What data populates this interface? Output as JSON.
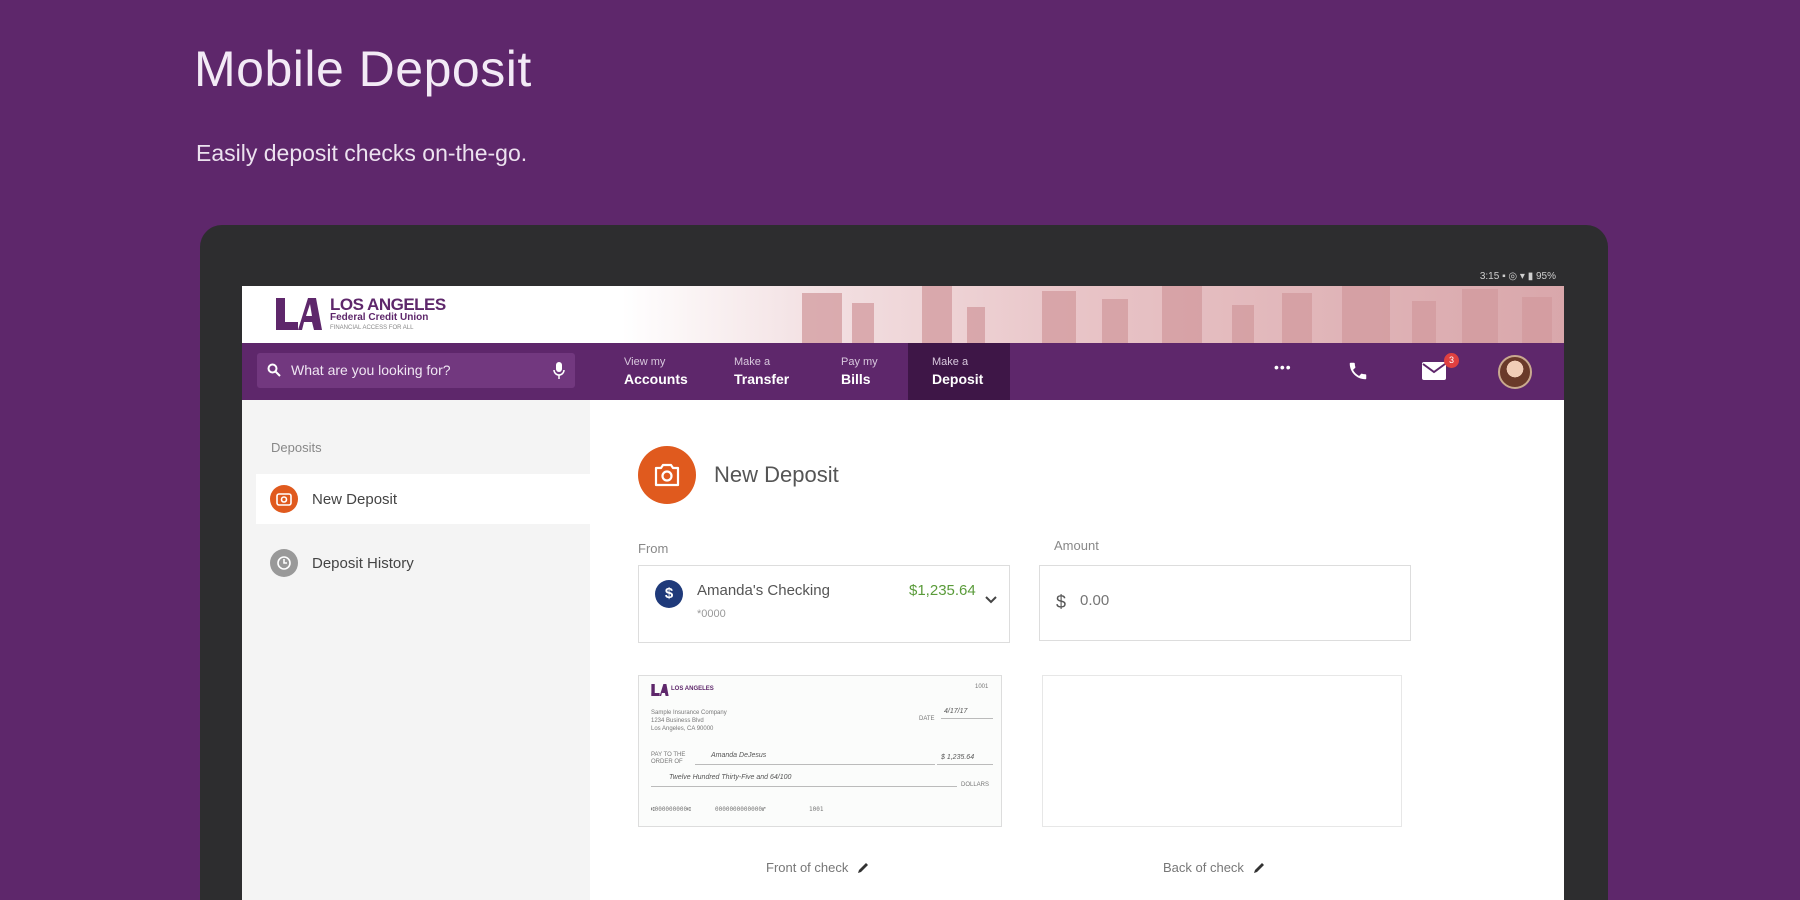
{
  "hero": {
    "title": "Mobile Deposit",
    "subtitle": "Easily deposit checks on-the-go."
  },
  "statusbar": {
    "text": "3:15 ▪ ◎ ▾ ▮ 95%"
  },
  "logo": {
    "line1": "LOS ANGELES",
    "line2": "Federal Credit Union",
    "line3": "FINANCIAL ACCESS FOR ALL",
    "mark": "LA"
  },
  "search": {
    "placeholder": "What are you looking for?"
  },
  "nav": {
    "tabs": [
      {
        "small": "View my",
        "big": "Accounts"
      },
      {
        "small": "Make a",
        "big": "Transfer"
      },
      {
        "small": "Pay my",
        "big": "Bills"
      },
      {
        "small": "Make a",
        "big": "Deposit"
      }
    ],
    "more": "•••",
    "mail_badge": "3"
  },
  "sidebar": {
    "heading": "Deposits",
    "items": [
      {
        "label": "New Deposit"
      },
      {
        "label": "Deposit History"
      }
    ]
  },
  "main": {
    "title": "New Deposit",
    "from_label": "From",
    "amount_label": "Amount",
    "account": {
      "icon": "$",
      "name": "Amanda's Checking",
      "number": "*0000",
      "balance": "$1,235.64"
    },
    "amount": {
      "symbol": "$",
      "placeholder": "0.00"
    },
    "front_caption": "Front of check",
    "back_caption": "Back of check"
  },
  "check": {
    "logo": "LA",
    "logo_text": "LOS ANGELES",
    "number": "1001",
    "payer_name": "Sample Insurance Company",
    "payer_address": "1234 Business Blvd",
    "payer_city": "Los Angeles, CA 90000",
    "date_label": "DATE",
    "date": "4/17/17",
    "pay_label": "PAY TO THE",
    "order_label": "ORDER OF",
    "payee": "Amanda DeJesus",
    "amount": "$ 1,235.64",
    "written": "Twelve Hundred Thirty-Five and 64/100",
    "dollars_label": "DOLLARS",
    "micr_routing": "⑆000000000⑆",
    "micr_account": "0000000000000⑈",
    "micr_number": "1001"
  },
  "colors": {
    "brand": "#5e276b",
    "brand_dark": "#3e1647",
    "accent": "#e05a1e",
    "positive": "#5a9b3a"
  },
  "icons": [
    "search-icon",
    "mic-icon",
    "more-icon",
    "phone-icon",
    "mail-icon",
    "camera-icon",
    "history-icon",
    "chevron-down-icon",
    "pencil-icon"
  ]
}
